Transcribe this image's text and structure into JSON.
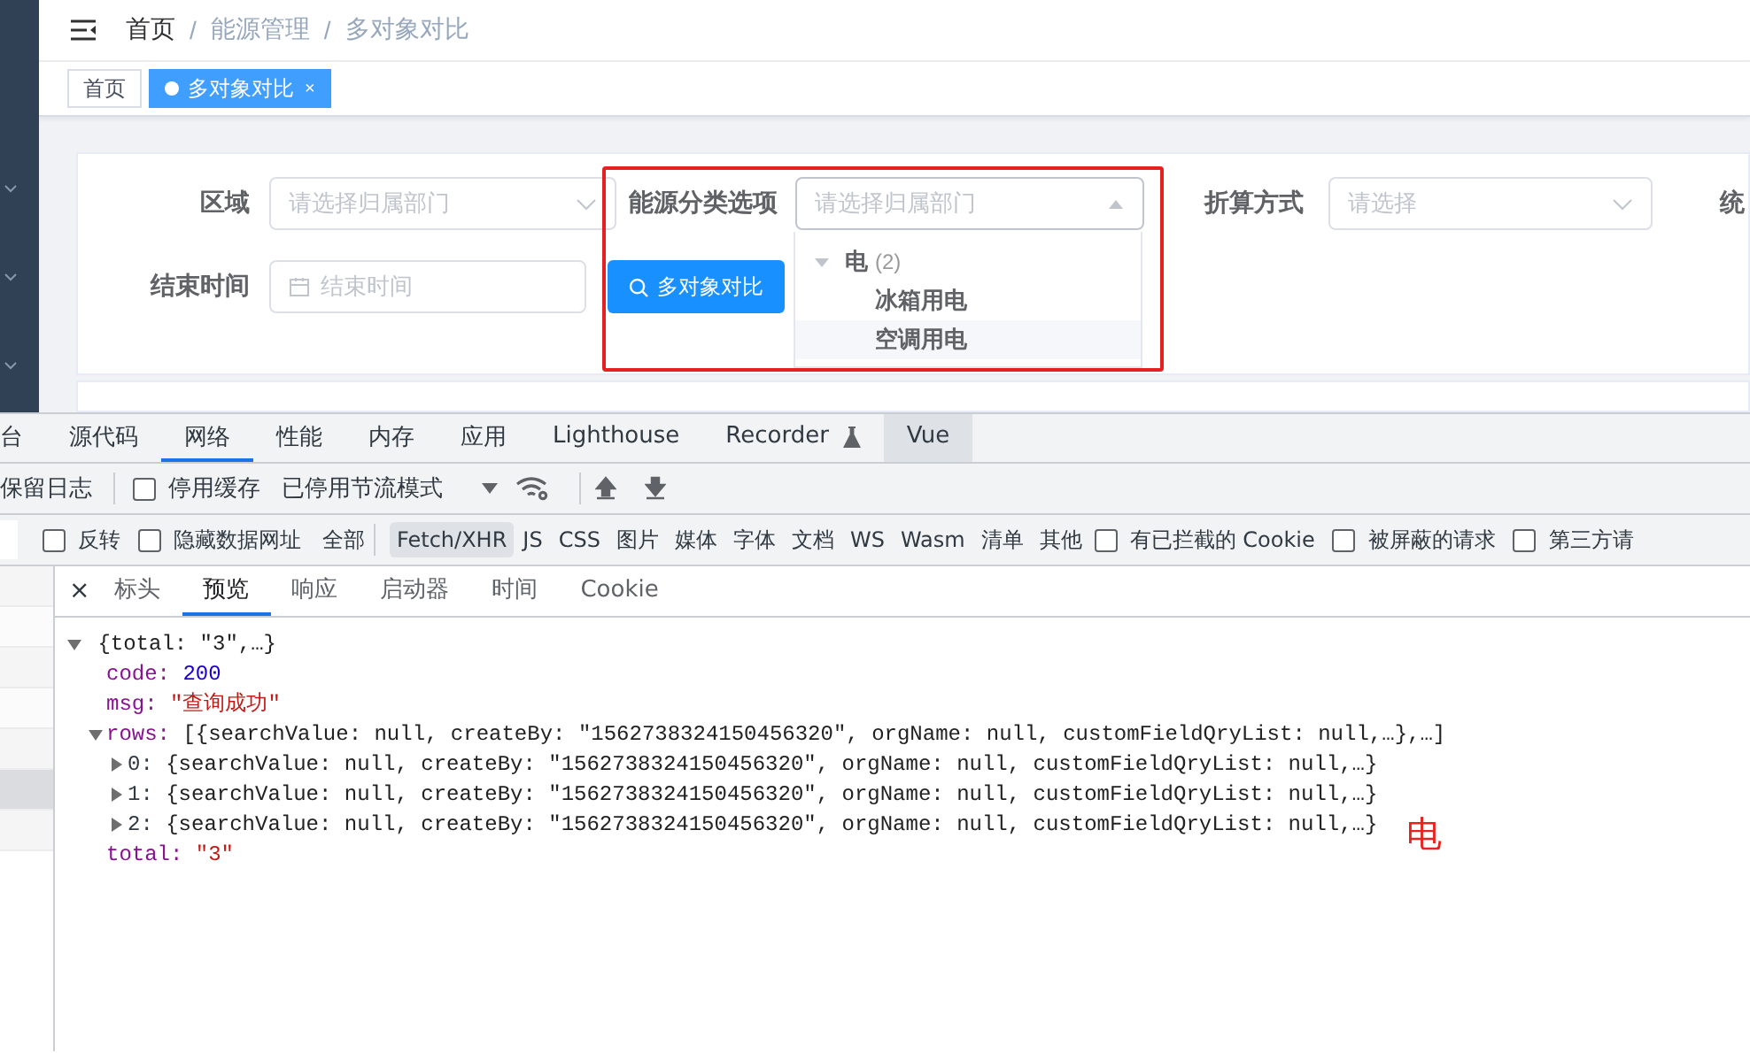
{
  "breadcrumb": {
    "separator": "/",
    "items": [
      "首页",
      "能源管理",
      "多对象对比"
    ]
  },
  "tags": [
    {
      "label": "首页",
      "selected": false
    },
    {
      "label": "多对象对比",
      "selected": true,
      "close": "×"
    }
  ],
  "form": {
    "fields": [
      {
        "kind": "select",
        "label": "区域",
        "placeholder": "请选择归属部门",
        "open": false
      },
      {
        "kind": "select",
        "label": "能源分类选项",
        "placeholder": "请选择归属部门",
        "open": true
      },
      {
        "kind": "select",
        "label": "折算方式",
        "placeholder": "请选择",
        "open": false
      },
      {
        "kind": "cut",
        "label": "统"
      },
      {
        "kind": "date",
        "label": "结束时间",
        "placeholder": "结束时间"
      }
    ],
    "button": "多对象对比",
    "dropdown": [
      {
        "label": "电",
        "count": "(2)",
        "expanded": true,
        "children": [
          {
            "label": "冰箱用电",
            "hovered": false
          },
          {
            "label": "空调用电",
            "hovered": true
          }
        ]
      }
    ]
  },
  "devtools": {
    "panels": [
      {
        "label": "台",
        "selected": false,
        "shaded": false
      },
      {
        "label": "源代码",
        "selected": false,
        "shaded": false
      },
      {
        "label": "网络",
        "selected": true,
        "shaded": false
      },
      {
        "label": "性能",
        "selected": false,
        "shaded": false
      },
      {
        "label": "内存",
        "selected": false,
        "shaded": false
      },
      {
        "label": "应用",
        "selected": false,
        "shaded": false
      },
      {
        "label": "Lighthouse",
        "selected": false,
        "shaded": false
      },
      {
        "label": "Recorder",
        "selected": false,
        "shaded": false,
        "experimental": true
      },
      {
        "label": "Vue",
        "selected": false,
        "shaded": true
      }
    ],
    "toolbar": [
      {
        "kind": "text",
        "label": "保留日志"
      },
      {
        "kind": "divider"
      },
      {
        "kind": "checkbox",
        "label": "停用缓存",
        "checked": false
      },
      {
        "kind": "dropdown",
        "label": "已停用节流模式"
      },
      {
        "kind": "network-conditions"
      },
      {
        "kind": "divider"
      },
      {
        "kind": "import"
      },
      {
        "kind": "export"
      }
    ],
    "filters": [
      {
        "kind": "input"
      },
      {
        "kind": "checkbox",
        "label": "反转",
        "checked": false
      },
      {
        "kind": "checkbox",
        "label": "隐藏数据网址",
        "checked": false
      },
      {
        "kind": "type",
        "label": "全部",
        "selected": false
      },
      {
        "kind": "divider"
      },
      {
        "kind": "type",
        "label": "Fetch/XHR",
        "selected": true
      },
      {
        "kind": "type",
        "label": "JS",
        "selected": false
      },
      {
        "kind": "type",
        "label": "CSS",
        "selected": false
      },
      {
        "kind": "type",
        "label": "图片",
        "selected": false
      },
      {
        "kind": "type",
        "label": "媒体",
        "selected": false
      },
      {
        "kind": "type",
        "label": "字体",
        "selected": false
      },
      {
        "kind": "type",
        "label": "文档",
        "selected": false
      },
      {
        "kind": "type",
        "label": "WS",
        "selected": false
      },
      {
        "kind": "type",
        "label": "Wasm",
        "selected": false
      },
      {
        "kind": "type",
        "label": "清单",
        "selected": false
      },
      {
        "kind": "type",
        "label": "其他",
        "selected": false
      },
      {
        "kind": "checkbox",
        "label": "有已拦截的 Cookie",
        "checked": false
      },
      {
        "kind": "checkbox",
        "label": "被屏蔽的请求",
        "checked": false
      },
      {
        "kind": "checkbox",
        "label": "第三方请",
        "checked": false
      }
    ],
    "detail_tabs": [
      {
        "kind": "close",
        "label": "×"
      },
      {
        "kind": "tab",
        "label": "标头",
        "selected": false
      },
      {
        "kind": "tab",
        "label": "预览",
        "selected": true
      },
      {
        "kind": "tab",
        "label": "响应",
        "selected": false
      },
      {
        "kind": "tab",
        "label": "启动器",
        "selected": false
      },
      {
        "kind": "tab",
        "label": "时间",
        "selected": false
      },
      {
        "kind": "tab",
        "label": "Cookie",
        "selected": false
      }
    ],
    "requests": [
      {
        "selected": false
      },
      {
        "selected": false
      },
      {
        "selected": false
      },
      {
        "selected": false
      },
      {
        "selected": false
      },
      {
        "selected": true
      },
      {
        "selected": false
      }
    ],
    "preview": {
      "summary": "{total: \"3\",…}",
      "expanded": true,
      "children": [
        {
          "key": "code:",
          "value": "200",
          "kind": "number"
        },
        {
          "key": "msg:",
          "value": "\"查询成功\"",
          "kind": "string"
        },
        {
          "key": "rows:",
          "value": "[{searchValue: null, createBy: \"1562738324150456320\", orgName: null, customFieldQryList: null,…},…]",
          "kind": "array",
          "expanded": true,
          "children": [
            {
              "key": "0:",
              "value": "{searchValue: null, createBy: \"1562738324150456320\", orgName: null, customFieldQryList: null,…}",
              "expanded": false
            },
            {
              "key": "1:",
              "value": "{searchValue: null, createBy: \"1562738324150456320\", orgName: null, customFieldQryList: null,…}",
              "expanded": false
            },
            {
              "key": "2:",
              "value": "{searchValue: null, createBy: \"1562738324150456320\", orgName: null, customFieldQryList: null,…}",
              "expanded": false
            }
          ]
        },
        {
          "key": "total:",
          "value": "\"3\"",
          "kind": "string"
        }
      ]
    }
  },
  "annotation": {
    "text": "电"
  }
}
